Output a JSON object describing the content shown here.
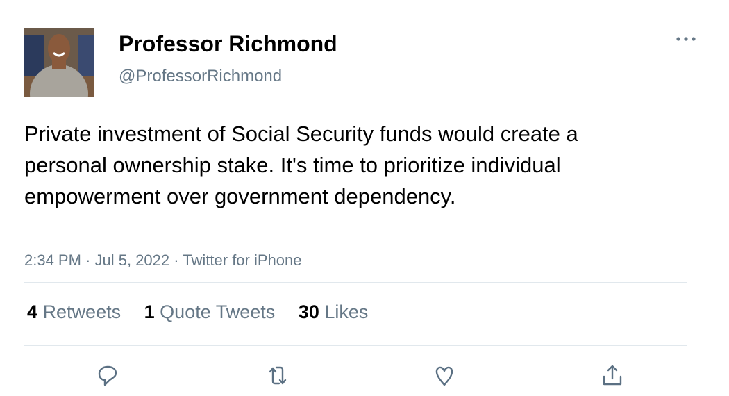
{
  "tweet": {
    "author_name": "Professor Richmond",
    "handle": "@ProfessorRichmond",
    "text": "Private investment of Social Security funds would create a personal ownership stake. It's time to prioritize individual empowerment over government dependency.",
    "time": "2:34 PM",
    "date": "Jul 5, 2022",
    "source": "Twitter for iPhone",
    "separator": " · "
  },
  "stats": [
    {
      "count": "4",
      "label": "Retweets"
    },
    {
      "count": "1",
      "label": "Quote Tweets"
    },
    {
      "count": "30",
      "label": "Likes"
    }
  ],
  "actions": [
    "reply-icon",
    "retweet-icon",
    "like-icon",
    "share-icon"
  ],
  "colors": {
    "secondary_text": "#657786",
    "icon": "#5b7083",
    "divider": "#e1e8ed"
  }
}
